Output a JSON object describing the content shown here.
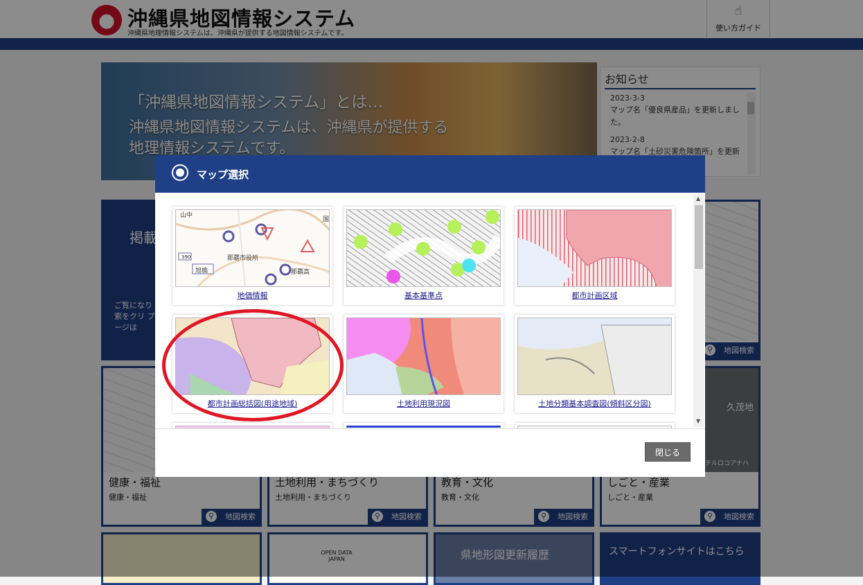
{
  "header": {
    "title": "沖縄県地図情報システム",
    "subtitle": "沖縄県地理情報システムは、沖縄県が提供する地図情報システムです。",
    "guide_label": "使い方ガイド"
  },
  "hero": {
    "line1": "「沖縄県地図情報システム」とは…",
    "line2": "沖縄県地図情報システムは、沖縄県が提供する",
    "line3": "地理情報システムです。"
  },
  "news": {
    "title": "お知らせ",
    "items": [
      {
        "date": "2023-3-3",
        "text": "マップ名「優良県産品」を更新しました。"
      },
      {
        "date": "2023-2-8",
        "text": "マップ名「土砂災害危険箇所」を更新しました。嘉手納"
      }
    ]
  },
  "tiles": {
    "partial_heading": "掲載",
    "partial_text": "ご覧になり 検索をクリ プページは",
    "search_label": "地図検索",
    "health": {
      "title": "健康・福祉",
      "sub": "健康・福祉"
    },
    "land": {
      "title": "土地利用・まちづくり",
      "sub": "土地利用・まちづくり"
    },
    "education": {
      "title": "教育・文化",
      "sub": "教育・文化"
    },
    "work": {
      "title": "しごと・産業",
      "sub": "しごと・産業"
    },
    "terrain_history": "県地形図更新履歴",
    "smartphone": "スマートフォンサイトはこちら",
    "open_data": "OPEN DATA JAPAN",
    "map_label_kumoji": "久茂地",
    "map_label_hotel": "ホテルロコアナハ"
  },
  "modal": {
    "title": "マップ選択",
    "close_label": "閉じる",
    "maps": [
      {
        "label": "地価情報"
      },
      {
        "label": "基本基準点"
      },
      {
        "label": "都市計画区域"
      },
      {
        "label": "都市計画総括図(用途地域)"
      },
      {
        "label": "土地利用現況図"
      },
      {
        "label": "土地分類基本調査図(傾斜区分図)"
      }
    ],
    "thumb_text": {
      "city_hall": "那覇市役所",
      "naha_high": "那覇高",
      "asahi": "旭橋",
      "route": "390",
      "yamanaka": "山中",
      "kuni": "国"
    }
  },
  "colors": {
    "brand_blue": "#1f3f86",
    "highlight_red": "#e01624",
    "link": "#1a1a8c"
  }
}
